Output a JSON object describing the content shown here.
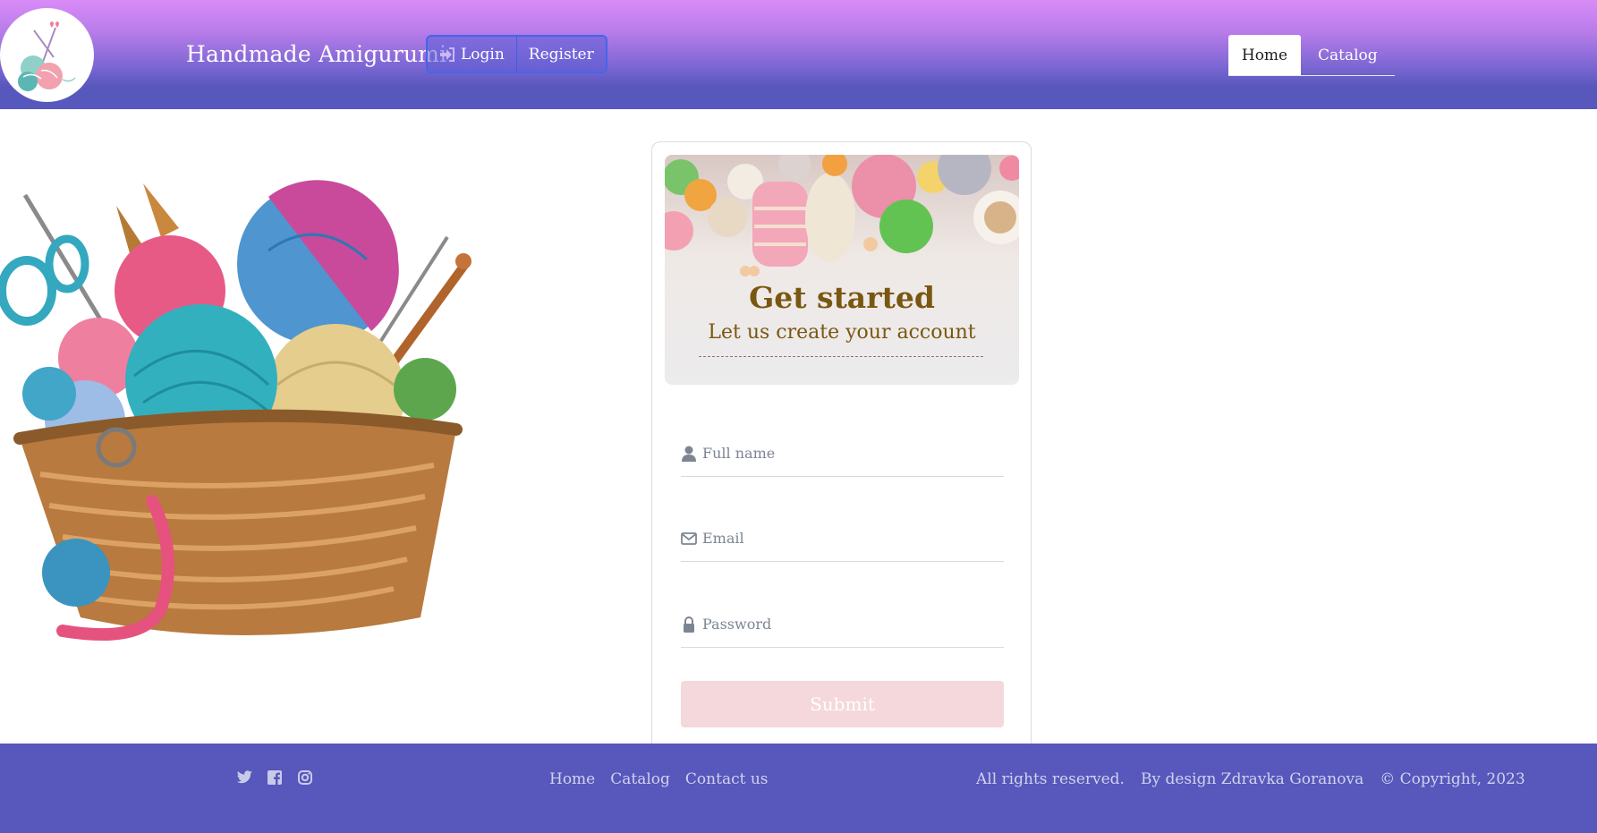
{
  "header": {
    "brand": "Handmade Amigurumi",
    "login_label": "Login",
    "register_label": "Register",
    "nav": [
      {
        "label": "Home",
        "active": true
      },
      {
        "label": "Catalog",
        "active": false
      }
    ]
  },
  "form": {
    "title": "Get started",
    "subtitle": "Let us create your account",
    "fullname_placeholder": "Full name",
    "email_placeholder": "Email",
    "password_placeholder": "Password",
    "submit_label": "Submit"
  },
  "footer": {
    "social_icons": [
      "twitter-icon",
      "facebook-icon",
      "instagram-icon"
    ],
    "links": [
      "Home",
      "Catalog",
      "Contact us"
    ],
    "rights": "All rights reserved.",
    "design": "By design Zdravka Goranova",
    "copyright": "© Copyright, 2023"
  },
  "colors": {
    "header_top": "#d98bf7",
    "header_bottom": "#5658bd",
    "footer_bg": "#5757bc",
    "title_brown": "#7a5710",
    "submit_bg": "#f4d8dc",
    "auth_border": "#4565e8"
  }
}
